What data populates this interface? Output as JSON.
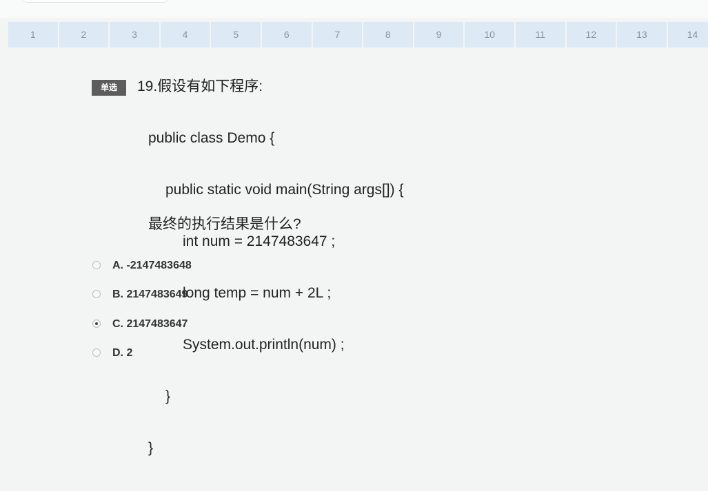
{
  "nav": {
    "items": [
      "1",
      "2",
      "3",
      "4",
      "5",
      "6",
      "7",
      "8",
      "9",
      "10",
      "11",
      "12",
      "13",
      "14"
    ]
  },
  "question": {
    "type_badge": "单选",
    "title": "19.假设有如下程序:",
    "code_lines": [
      "public class Demo {",
      "public static void main(String args[]) {",
      "int num = 2147483647 ;",
      "long temp = num + 2L ;",
      "System.out.println(num) ;",
      "}",
      "}"
    ],
    "prompt": "最终的执行结果是什么?"
  },
  "options": [
    {
      "label": "A. -2147483648",
      "selected": false
    },
    {
      "label": "B. 2147483649",
      "selected": false
    },
    {
      "label": "C. 2147483647",
      "selected": true
    },
    {
      "label": "D. 2",
      "selected": false
    }
  ],
  "colors": {
    "background": "#f3f5f5",
    "nav_item_bg": "#dde9f5",
    "nav_item_text": "#8a939b",
    "badge_bg": "#5c5c5c"
  }
}
